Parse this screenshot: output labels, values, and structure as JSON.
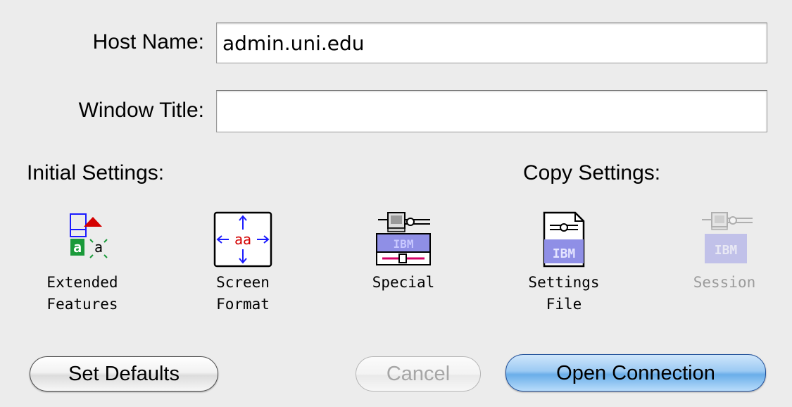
{
  "host": {
    "label": "Host Name:",
    "value": "admin.uni.edu",
    "placeholder": ""
  },
  "window_title": {
    "label": "Window Title:",
    "value": "",
    "placeholder": ""
  },
  "sections": {
    "initial": "Initial Settings:",
    "copy": "Copy Settings:"
  },
  "tools": [
    {
      "id": "extended",
      "caption": "Extended\nFeatures",
      "icon": "extended-features-icon",
      "enabled": true
    },
    {
      "id": "screen",
      "caption": "Screen\nFormat",
      "icon": "screen-format-icon",
      "enabled": true
    },
    {
      "id": "special",
      "caption": "Special",
      "icon": "special-terminal-icon",
      "enabled": true
    },
    {
      "id": "settings_file",
      "caption": "Settings\nFile",
      "icon": "ibm-settings-file-icon",
      "enabled": true
    },
    {
      "id": "session",
      "caption": "Session",
      "icon": "ibm-session-icon",
      "enabled": false
    }
  ],
  "buttons": {
    "set_defaults": "Set Defaults",
    "cancel": "Cancel",
    "open_connection": "Open Connection"
  },
  "colors": {
    "default_button": "#6aaee9",
    "disabled_text": "#9b9b9b",
    "ibm_blue": "#8f8fe6",
    "accent_red": "#d40000",
    "accent_green": "#1a9a3a"
  }
}
